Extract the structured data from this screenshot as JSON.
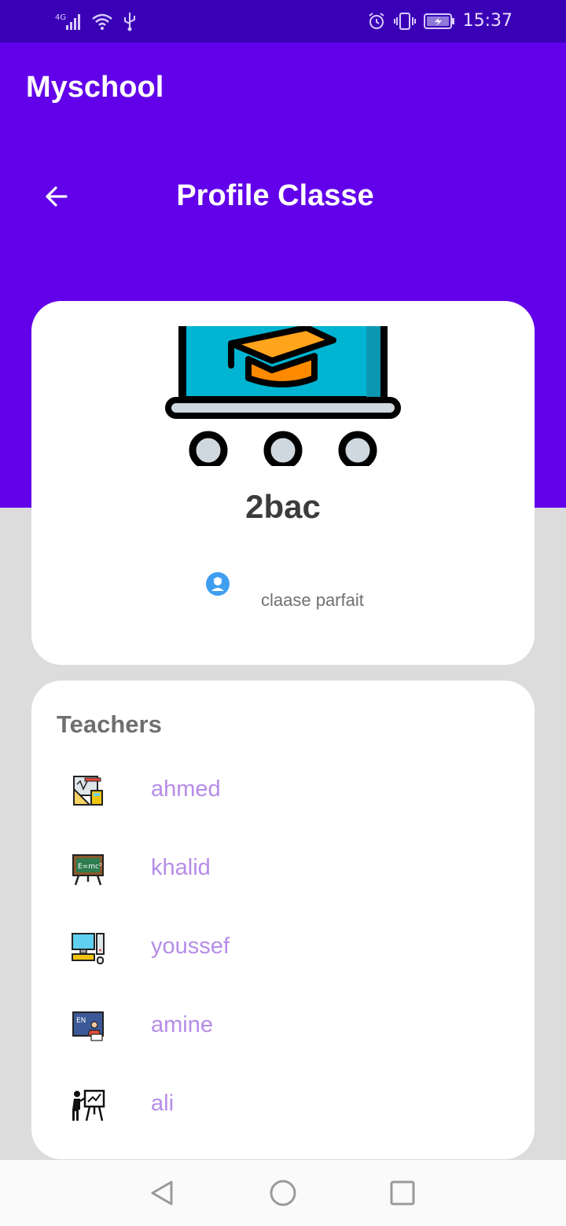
{
  "status_bar": {
    "network": "4G",
    "time": "15:37"
  },
  "app": {
    "title": "Myschool",
    "page_title": "Profile Classe",
    "colors": {
      "primary": "#6200ea",
      "status": "#3a00b6",
      "accent_text": "#b68ce8"
    }
  },
  "profile": {
    "illustration": "classroom-graduation-icon",
    "class_name": "2bac",
    "description_icon": "student-icon",
    "description": "claase parfait"
  },
  "teachers": {
    "heading": "Teachers",
    "items": [
      {
        "name": "ahmed",
        "icon": "math-tools-icon"
      },
      {
        "name": "khalid",
        "icon": "physics-board-icon"
      },
      {
        "name": "youssef",
        "icon": "computer-icon"
      },
      {
        "name": "amine",
        "icon": "english-board-icon"
      },
      {
        "name": "ali",
        "icon": "presenter-icon"
      }
    ]
  },
  "nav": {
    "back": "back-triangle-icon",
    "home": "home-circle-icon",
    "recents": "recents-square-icon"
  }
}
